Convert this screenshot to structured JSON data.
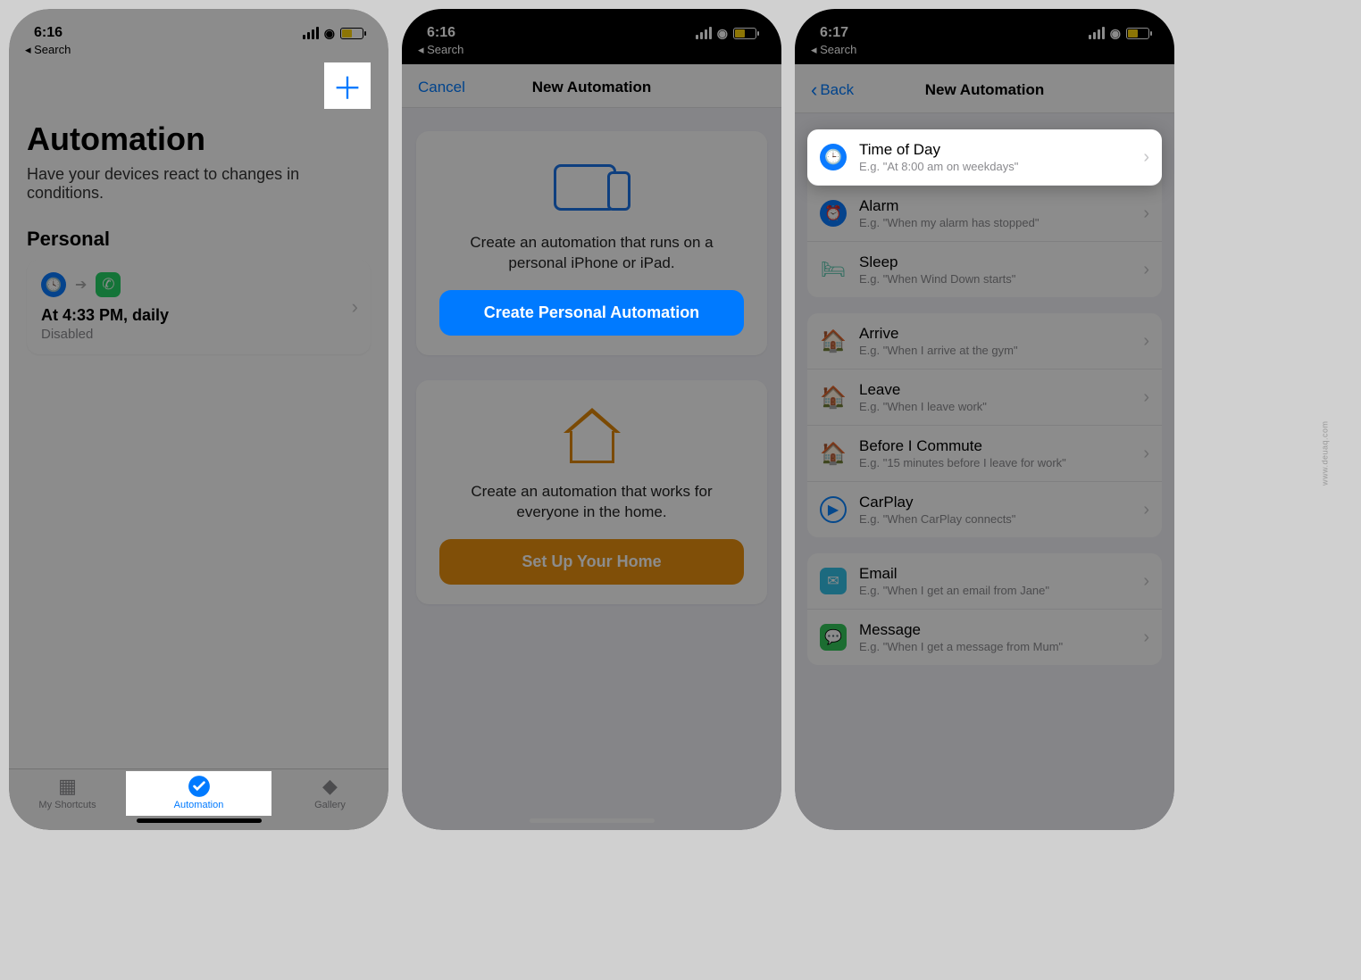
{
  "statusbar": {
    "time1": "6:16",
    "time2": "6:16",
    "time3": "6:17",
    "back_search": "◂ Search"
  },
  "screen1": {
    "title": "Automation",
    "subtitle": "Have your devices react to changes in conditions.",
    "section": "Personal",
    "card_title": "At 4:33 PM, daily",
    "card_status": "Disabled",
    "tabs": {
      "shortcuts": "My Shortcuts",
      "automation": "Automation",
      "gallery": "Gallery"
    }
  },
  "screen2": {
    "nav_cancel": "Cancel",
    "nav_title": "New Automation",
    "personal_text": "Create an automation that runs on a personal iPhone or iPad.",
    "personal_button": "Create Personal Automation",
    "home_text": "Create an automation that works for everyone in the home.",
    "home_button": "Set Up Your Home"
  },
  "screen3": {
    "nav_back": "Back",
    "nav_title": "New Automation",
    "group1": [
      {
        "title": "Time of Day",
        "sub": "E.g. \"At 8:00 am on weekdays\""
      },
      {
        "title": "Alarm",
        "sub": "E.g. \"When my alarm has stopped\""
      },
      {
        "title": "Sleep",
        "sub": "E.g. \"When Wind Down starts\""
      }
    ],
    "group2": [
      {
        "title": "Arrive",
        "sub": "E.g. \"When I arrive at the gym\""
      },
      {
        "title": "Leave",
        "sub": "E.g. \"When I leave work\""
      },
      {
        "title": "Before I Commute",
        "sub": "E.g. \"15 minutes before I leave for work\""
      },
      {
        "title": "CarPlay",
        "sub": "E.g. \"When CarPlay connects\""
      }
    ],
    "group3": [
      {
        "title": "Email",
        "sub": "E.g. \"When I get an email from Jane\""
      },
      {
        "title": "Message",
        "sub": "E.g. \"When I get a message from Mum\""
      }
    ]
  },
  "watermark": "www.deuaq.com"
}
